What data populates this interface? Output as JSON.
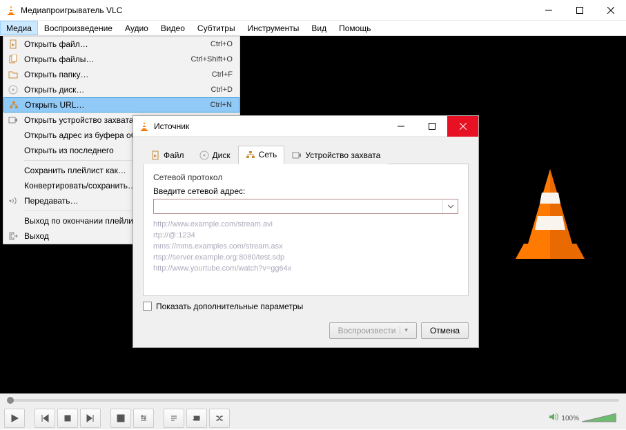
{
  "window": {
    "title": "Медиапроигрыватель VLC"
  },
  "menubar": [
    "Медиа",
    "Воспроизведение",
    "Аудио",
    "Видео",
    "Субтитры",
    "Инструменты",
    "Вид",
    "Помощь"
  ],
  "media_menu": {
    "items": [
      {
        "label": "Открыть файл…",
        "shortcut": "Ctrl+O",
        "icon": "file"
      },
      {
        "label": "Открыть файлы…",
        "shortcut": "Ctrl+Shift+O",
        "icon": "files"
      },
      {
        "label": "Открыть папку…",
        "shortcut": "Ctrl+F",
        "icon": "folder"
      },
      {
        "label": "Открыть диск…",
        "shortcut": "Ctrl+D",
        "icon": "disc"
      },
      {
        "label": "Открыть URL…",
        "shortcut": "Ctrl+N",
        "icon": "network",
        "highlight": true
      },
      {
        "label": "Открыть устройство захвата…",
        "shortcut": "",
        "icon": "capture"
      },
      {
        "label": "Открыть адрес из буфера обмена",
        "shortcut": "",
        "icon": ""
      },
      {
        "label": "Открыть из последнего",
        "shortcut": "",
        "icon": "",
        "sub": true
      },
      {
        "sep": true
      },
      {
        "label": "Сохранить плейлист как…",
        "shortcut": "",
        "icon": ""
      },
      {
        "label": "Конвертировать/сохранить…",
        "shortcut": "",
        "icon": ""
      },
      {
        "label": "Передавать…",
        "shortcut": "",
        "icon": "stream"
      },
      {
        "sep": true
      },
      {
        "label": "Выход по окончании плейлиста",
        "shortcut": "",
        "icon": ""
      },
      {
        "label": "Выход",
        "shortcut": "",
        "icon": "exit"
      }
    ]
  },
  "dialog": {
    "title": "Источник",
    "tabs": [
      "Файл",
      "Диск",
      "Сеть",
      "Устройство захвата"
    ],
    "active_tab": 2,
    "group_title": "Сетевой протокол",
    "input_label": "Введите сетевой адрес:",
    "input_value": "",
    "examples": [
      "http://www.example.com/stream.avi",
      "rtp://@:1234",
      "mms://mms.examples.com/stream.asx",
      "rtsp://server.example.org:8080/test.sdp",
      "http://www.yourtube.com/watch?v=gg64x"
    ],
    "adv_checkbox": "Показать дополнительные параметры",
    "play_btn": "Воспроизвести",
    "cancel_btn": "Отмена"
  },
  "volume": {
    "percent": "100%"
  }
}
